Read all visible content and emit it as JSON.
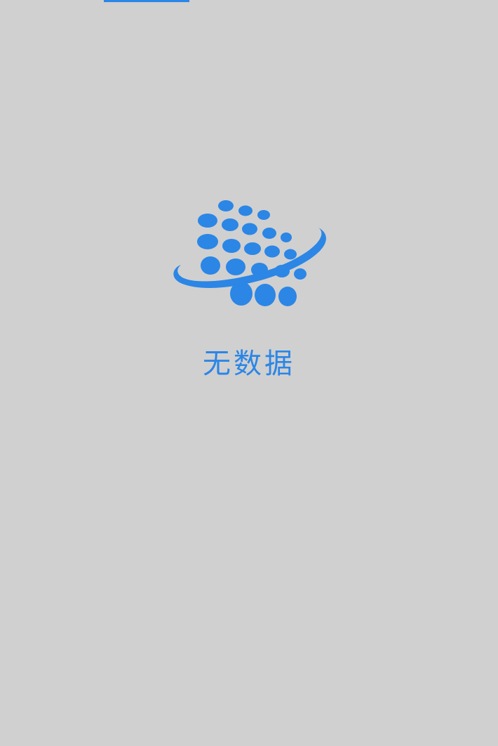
{
  "empty_state": {
    "message": "无数据",
    "icon": "no-data-globe-icon"
  },
  "colors": {
    "background": "#d0d0d0",
    "accent": "#2b86e6"
  },
  "top_tab_indicator": {
    "active": true
  }
}
